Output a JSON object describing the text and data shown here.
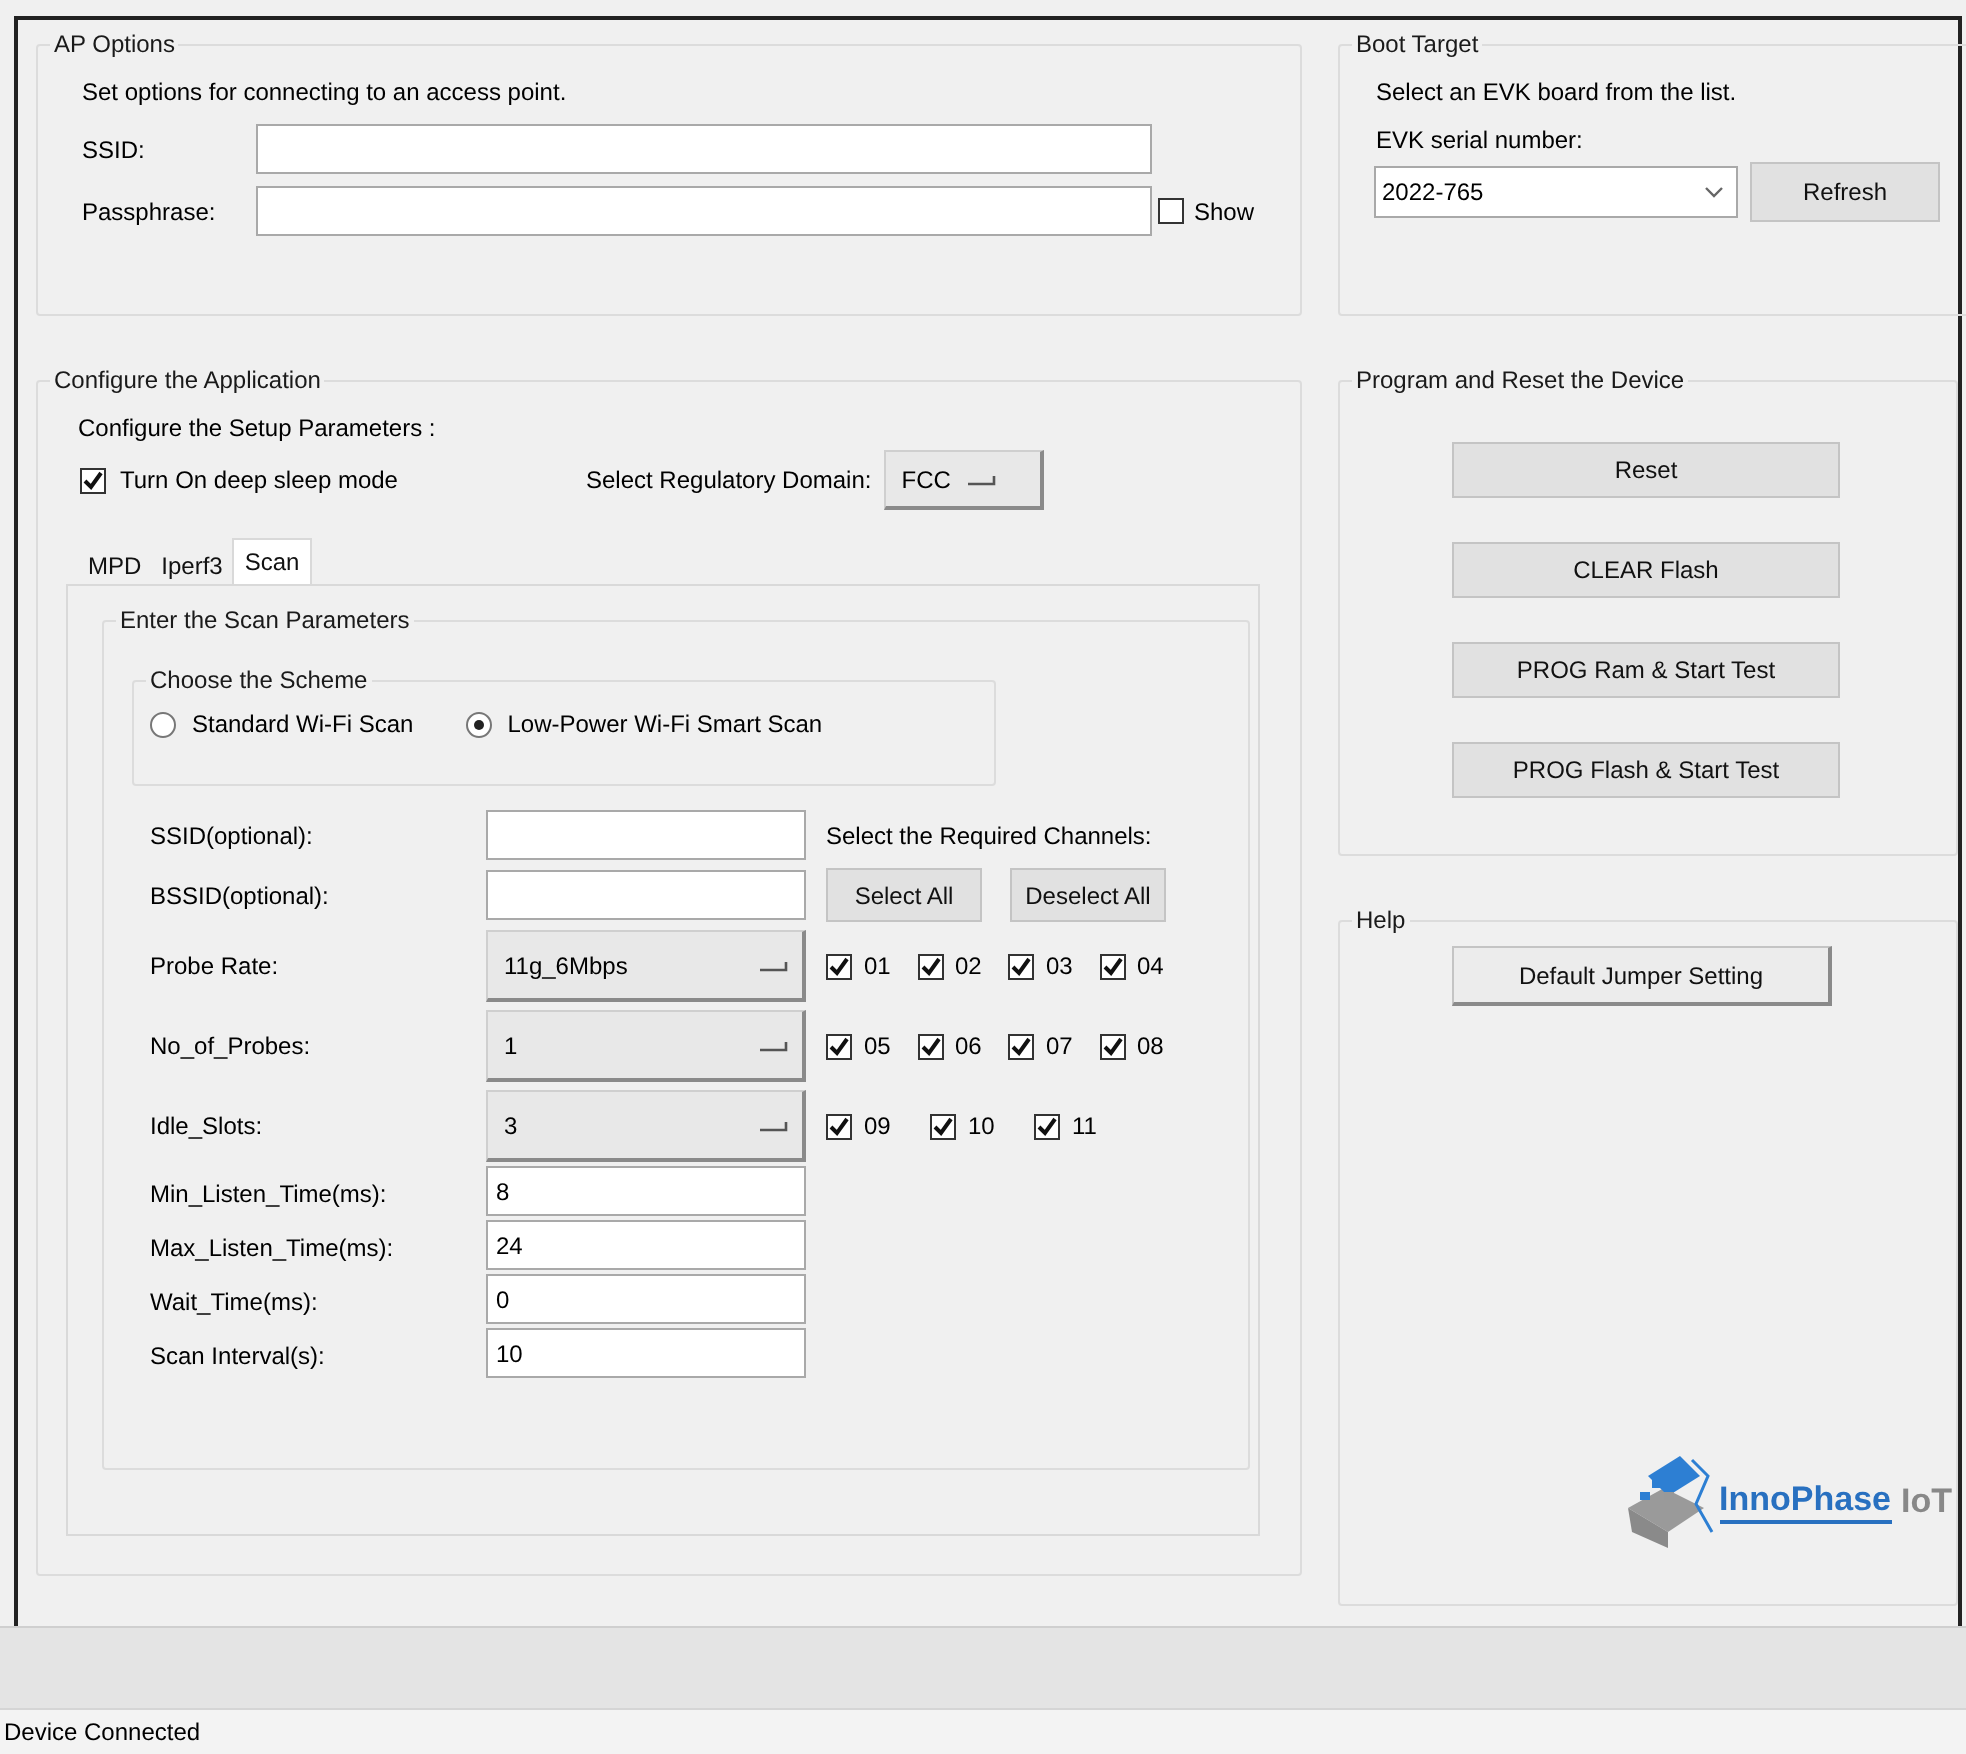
{
  "ap_options": {
    "title": "AP Options",
    "description": "Set options for connecting to an access point.",
    "fields": [
      {
        "label": "SSID:"
      },
      {
        "label": "Passphrase:"
      }
    ],
    "show_checkbox": {
      "label": "Show",
      "checked": false
    }
  },
  "configure": {
    "title": "Configure the Application",
    "subtitle": "Configure the Setup Parameters :",
    "deep_sleep": {
      "label": "Turn On deep sleep mode",
      "checked": true
    },
    "regulatory": {
      "label": "Select Regulatory Domain:",
      "value": "FCC"
    },
    "tabs": [
      {
        "label": "MPD",
        "selected": false
      },
      {
        "label": "Iperf3",
        "selected": false
      },
      {
        "label": "Scan",
        "selected": true
      }
    ],
    "scan": {
      "title": "Enter the Scan Parameters",
      "scheme": {
        "title": "Choose the Scheme",
        "options": [
          {
            "label": "Standard Wi-Fi Scan",
            "selected": false
          },
          {
            "label": "Low-Power Wi-Fi Smart Scan",
            "selected": true
          }
        ]
      },
      "params": [
        {
          "kind": "text",
          "label": "SSID(optional):"
        },
        {
          "kind": "text",
          "label": "BSSID(optional):"
        },
        {
          "kind": "dropdown",
          "label": "Probe Rate:",
          "value": "11g_6Mbps"
        },
        {
          "kind": "dropdown",
          "label": "No_of_Probes:",
          "value": "1"
        },
        {
          "kind": "dropdown",
          "label": "Idle_Slots:",
          "value": "3"
        },
        {
          "kind": "text",
          "label": "Min_Listen_Time(ms):",
          "value": "8"
        },
        {
          "kind": "text",
          "label": "Max_Listen_Time(ms):",
          "value": "24"
        },
        {
          "kind": "text",
          "label": "Wait_Time(ms):",
          "value": "0"
        },
        {
          "kind": "text",
          "label": "Scan Interval(s):",
          "value": "10"
        }
      ],
      "channels": {
        "title": "Select the Required Channels:",
        "buttons": [
          "Select All",
          "Deselect All"
        ],
        "items": [
          {
            "label": "01",
            "checked": true
          },
          {
            "label": "02",
            "checked": true
          },
          {
            "label": "03",
            "checked": true
          },
          {
            "label": "04",
            "checked": true
          },
          {
            "label": "05",
            "checked": true
          },
          {
            "label": "06",
            "checked": true
          },
          {
            "label": "07",
            "checked": true
          },
          {
            "label": "08",
            "checked": true
          },
          {
            "label": "09",
            "checked": true
          },
          {
            "label": "10",
            "checked": true
          },
          {
            "label": "11",
            "checked": true
          }
        ]
      }
    }
  },
  "boot_target": {
    "title": "Boot Target",
    "description": "Select an EVK board from the list.",
    "serial_label": "EVK serial number:",
    "serial_value": "2022-765",
    "refresh_button": "Refresh"
  },
  "program": {
    "title": "Program and Reset the Device",
    "buttons": [
      "Reset",
      "CLEAR Flash",
      "PROG Ram & Start Test",
      "PROG Flash & Start Test"
    ]
  },
  "help": {
    "title": "Help",
    "buttons": [
      "Default Jumper Setting"
    ]
  },
  "logo": {
    "name": "InnoPhase",
    "suffix": "IoT"
  },
  "status_bar": {
    "text": "Device Connected"
  }
}
